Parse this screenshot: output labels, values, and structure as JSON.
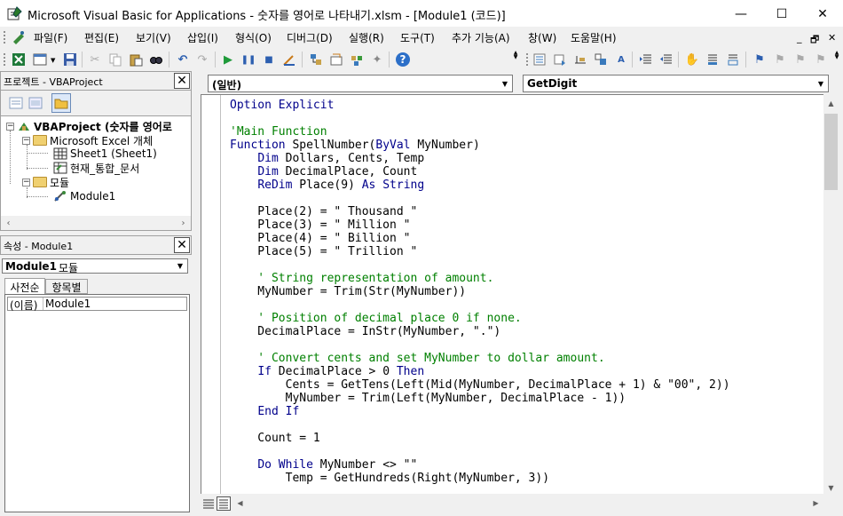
{
  "window": {
    "title": "Microsoft Visual Basic for Applications - 숫자를 영어로 나타내기.xlsm - [Module1 (코드)]",
    "minimize": "—",
    "maximize": "☐",
    "close": "✕"
  },
  "menu": {
    "items": [
      "파일(F)",
      "편집(E)",
      "보기(V)",
      "삽입(I)",
      "형식(O)",
      "디버그(D)",
      "실행(R)",
      "도구(T)",
      "추가 기능(A)",
      "창(W)",
      "도움말(H)"
    ],
    "mdi_min": "_",
    "mdi_restore": "🗗",
    "mdi_close": "✕"
  },
  "project_pane": {
    "title": "프로젝트 - VBAProject",
    "tree": {
      "root": "VBAProject (숫자를 영어로",
      "excel_objects": "Microsoft Excel 개체",
      "sheet1": "Sheet1 (Sheet1)",
      "thisworkbook": "현재_통합_문서",
      "modules": "모듈",
      "module1": "Module1"
    }
  },
  "properties_pane": {
    "title": "속성 - Module1",
    "object_name": "Module1",
    "object_type": "모듈",
    "tabs": [
      "사전순",
      "항목별"
    ],
    "rows": [
      {
        "name": "(이름)",
        "value": "Module1"
      }
    ]
  },
  "code_window": {
    "object_combo": "(일반)",
    "procedure_combo": "GetDigit",
    "lines": [
      {
        "segs": [
          {
            "t": "Option Explicit",
            "c": "kw"
          }
        ]
      },
      {
        "segs": []
      },
      {
        "segs": [
          {
            "t": "'Main Function",
            "c": "cm"
          }
        ]
      },
      {
        "segs": [
          {
            "t": "Function",
            "c": "kw"
          },
          {
            "t": " SpellNumber(",
            "c": "tx"
          },
          {
            "t": "ByVal",
            "c": "kw"
          },
          {
            "t": " MyNumber)",
            "c": "tx"
          }
        ]
      },
      {
        "segs": [
          {
            "t": "    ",
            "c": "tx"
          },
          {
            "t": "Dim",
            "c": "kw"
          },
          {
            "t": " Dollars, Cents, Temp",
            "c": "tx"
          }
        ]
      },
      {
        "segs": [
          {
            "t": "    ",
            "c": "tx"
          },
          {
            "t": "Dim",
            "c": "kw"
          },
          {
            "t": " DecimalPlace, Count",
            "c": "tx"
          }
        ]
      },
      {
        "segs": [
          {
            "t": "    ",
            "c": "tx"
          },
          {
            "t": "ReDim",
            "c": "kw"
          },
          {
            "t": " Place(9) ",
            "c": "tx"
          },
          {
            "t": "As String",
            "c": "kw"
          }
        ]
      },
      {
        "segs": []
      },
      {
        "segs": [
          {
            "t": "    Place(2) = \" Thousand \"",
            "c": "tx"
          }
        ]
      },
      {
        "segs": [
          {
            "t": "    Place(3) = \" Million \"",
            "c": "tx"
          }
        ]
      },
      {
        "segs": [
          {
            "t": "    Place(4) = \" Billion \"",
            "c": "tx"
          }
        ]
      },
      {
        "segs": [
          {
            "t": "    Place(5) = \" Trillion \"",
            "c": "tx"
          }
        ]
      },
      {
        "segs": []
      },
      {
        "segs": [
          {
            "t": "    ' String representation of amount.",
            "c": "cm"
          }
        ]
      },
      {
        "segs": [
          {
            "t": "    MyNumber = Trim(Str(MyNumber))",
            "c": "tx"
          }
        ]
      },
      {
        "segs": []
      },
      {
        "segs": [
          {
            "t": "    ' Position of decimal place 0 if none.",
            "c": "cm"
          }
        ]
      },
      {
        "segs": [
          {
            "t": "    DecimalPlace = InStr(MyNumber, \".\")",
            "c": "tx"
          }
        ]
      },
      {
        "segs": []
      },
      {
        "segs": [
          {
            "t": "    ' Convert cents and set MyNumber to dollar amount.",
            "c": "cm"
          }
        ]
      },
      {
        "segs": [
          {
            "t": "    ",
            "c": "tx"
          },
          {
            "t": "If",
            "c": "kw"
          },
          {
            "t": " DecimalPlace > 0 ",
            "c": "tx"
          },
          {
            "t": "Then",
            "c": "kw"
          }
        ]
      },
      {
        "segs": [
          {
            "t": "        Cents = GetTens(Left(Mid(MyNumber, DecimalPlace + 1) & \"00\", 2))",
            "c": "tx"
          }
        ]
      },
      {
        "segs": [
          {
            "t": "        MyNumber = Trim(Left(MyNumber, DecimalPlace - 1))",
            "c": "tx"
          }
        ]
      },
      {
        "segs": [
          {
            "t": "    ",
            "c": "tx"
          },
          {
            "t": "End If",
            "c": "kw"
          }
        ]
      },
      {
        "segs": []
      },
      {
        "segs": [
          {
            "t": "    Count = 1",
            "c": "tx"
          }
        ]
      },
      {
        "segs": []
      },
      {
        "segs": [
          {
            "t": "    ",
            "c": "tx"
          },
          {
            "t": "Do While",
            "c": "kw"
          },
          {
            "t": " MyNumber <> \"\"",
            "c": "tx"
          }
        ]
      },
      {
        "segs": [
          {
            "t": "        Temp = GetHundreds(Right(MyNumber, 3))",
            "c": "tx"
          }
        ]
      }
    ]
  },
  "colors": {
    "keyword": "#00008b",
    "comment": "#008000",
    "text": "#000000"
  },
  "icons": [
    "excel-icon",
    "view-object-icon",
    "save-icon",
    "cut-icon",
    "copy-icon",
    "paste-icon",
    "find-icon",
    "undo-icon",
    "redo-icon",
    "run-icon",
    "break-icon",
    "reset-icon",
    "design-mode-icon",
    "project-explorer-icon",
    "properties-icon",
    "object-browser-icon",
    "toolbox-icon",
    "help-icon"
  ]
}
